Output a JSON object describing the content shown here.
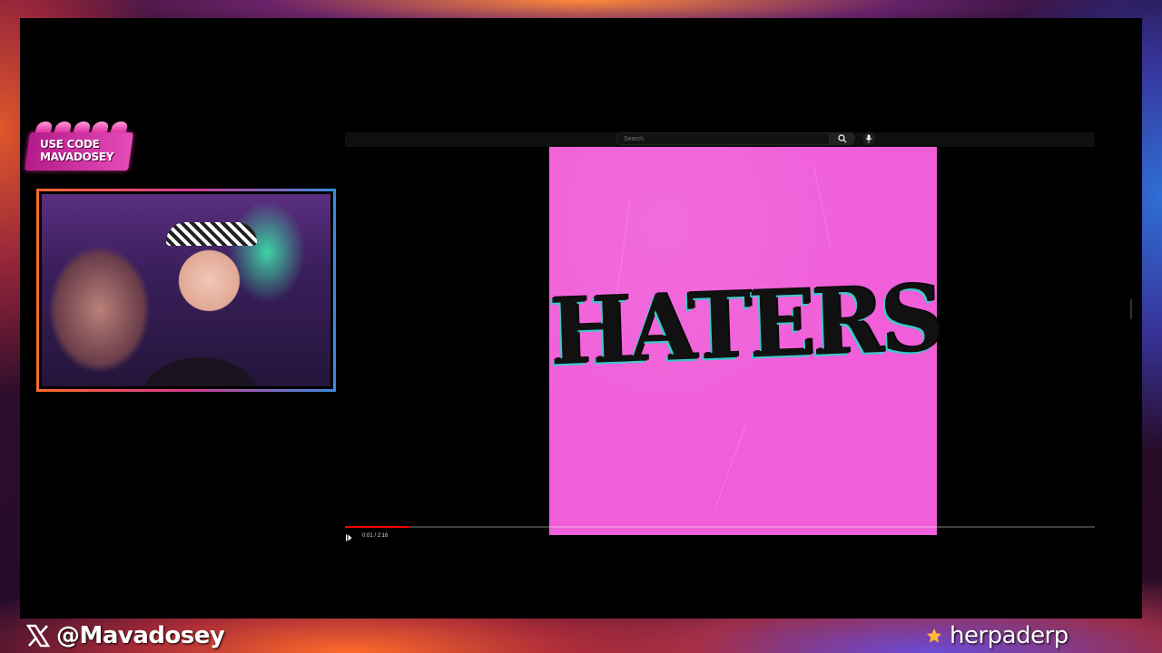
{
  "promo": {
    "line1": "USE CODE",
    "line2": "MAVADOSEY"
  },
  "youtube": {
    "search": {
      "placeholder": "Search"
    },
    "video": {
      "cover_title": "HATERS",
      "time_display": "0:01 / 2:16",
      "progress_fraction": 0.086
    }
  },
  "social": {
    "left": {
      "icon": "x-logo-icon",
      "handle": "@Mavadosey"
    },
    "right": {
      "icon": "star-icon",
      "name": "herpaderp"
    }
  },
  "colors": {
    "cover_pink": "#f15ed9",
    "progress_red": "#ff0000"
  }
}
